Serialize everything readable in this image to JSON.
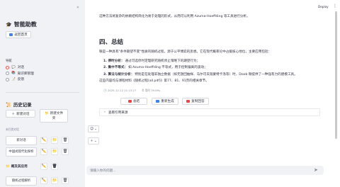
{
  "sidebar": {
    "app_title": "智能助教",
    "back_button": "返回首页",
    "nav_label": "导航",
    "nav_items": [
      {
        "label": "对话",
        "icon": "speech-balloon"
      },
      {
        "label": "知识库管理",
        "icon": "books"
      },
      {
        "label": "反馈",
        "icon": "memo"
      }
    ],
    "history_title": "历史记录",
    "new_chat_button": "新建对话",
    "new_folder_button_line1": "新建文件",
    "new_folder_button_line2": "夹",
    "unfiled_label": "未归类对话",
    "conversations": [
      {
        "label": "新对话"
      },
      {
        "label": "中国式现代化探析"
      }
    ],
    "folder": {
      "label": "概及其应用"
    },
    "folder_conversations": [
      {
        "label": "随机过程解析"
      }
    ]
  },
  "header": {
    "deploy_label": "Deploy",
    "menu_glyph": "⋮"
  },
  "main": {
    "top_text": "这种方法将复杂的依赖结构简化为易于处理的形式，从而可以利用 Azuma-Hoeffding 等工具进行分析。",
    "section_title": "四、总结",
    "intro": "鞅是一种具有\"条件期望不变\"性质的随机过程，源于公平博弈的思想。它在现代概率论中占据核心地位，主要应用包括：",
    "list": [
      {
        "bold": "1. 停时分析：",
        "text": "通过可选停时定理研究随机停止策略下的期望行为；"
      },
      {
        "bold": "2. 集中不等式：",
        "text": "如 Azuma-Hoeffding 不等式，用于控制偏离的波动；"
      },
      {
        "bold": "3. 算法与统计分析：",
        "text": "特别是在处理非独立数据（如无放回抽样、马尔可夫链蒙特卡洛等）时，Doob 鞅提供了一种强有力的建模工具。"
      }
    ],
    "note": "这些内容均与课程材料《随机过程(all.pdf)》第77、81、91页的相关章节。",
    "timestamp": "2025-12-12 21:13:27",
    "duration": "用时 39.89s",
    "actions": [
      {
        "label": "总结",
        "color": "#ef4444"
      },
      {
        "label": "重新生成",
        "color": "#3b82f6"
      },
      {
        "label": "复制回答",
        "color": "#ef4444"
      }
    ],
    "expander_label": "查看引用来源",
    "chat_placeholder": "请输入你的问题..."
  }
}
